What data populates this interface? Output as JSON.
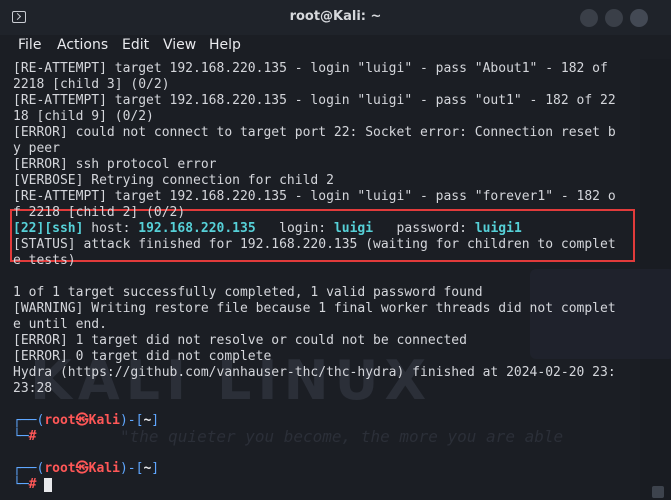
{
  "window": {
    "title": "root@Kali: ~"
  },
  "menu": {
    "file": "File",
    "actions": "Actions",
    "edit": "Edit",
    "view": "View",
    "help": "Help"
  },
  "terminal": {
    "lines": [
      "[RE-ATTEMPT] target 192.168.220.135 - login \"luigi\" - pass \"About1\" - 182 of",
      "2218 [child 3] (0/2)",
      "[RE-ATTEMPT] target 192.168.220.135 - login \"luigi\" - pass \"out1\" - 182 of 22",
      "18 [child 9] (0/2)",
      "[ERROR] could not connect to target port 22: Socket error: Connection reset b",
      "y peer",
      "[ERROR] ssh protocol error",
      "[VERBOSE] Retrying connection for child 2",
      "[RE-ATTEMPT] target 192.168.220.135 - login \"luigi\" - pass \"forever1\" - 182 o",
      "f 2218 [child 2] (0/2)"
    ],
    "found": {
      "port": "22",
      "service": "ssh",
      "host_label": " host: ",
      "host": "192.168.220.135",
      "login_label": "   login: ",
      "login": "luigi",
      "password_label": "   password: ",
      "password": "luigi1"
    },
    "status_lines": [
      "[STATUS] attack finished for 192.168.220.135 (waiting for children to complet",
      "e tests)"
    ],
    "summary_lines": [
      "",
      "1 of 1 target successfully completed, 1 valid password found",
      "[WARNING] Writing restore file because 1 final worker threads did not complet",
      "e until end.",
      "[ERROR] 1 target did not resolve or could not be connected",
      "[ERROR] 0 target did not complete",
      "Hydra (https://github.com/vanhauser-thc/thc-hydra) finished at 2024-02-20 23:",
      "23:28",
      ""
    ],
    "prompt": {
      "user": "root",
      "at": "㉿",
      "host": "Kali",
      "path": "~",
      "symbol": "#"
    },
    "background_tagline": "\"the quieter you become, the more you are able",
    "background_logo": "KALI LINUX"
  }
}
